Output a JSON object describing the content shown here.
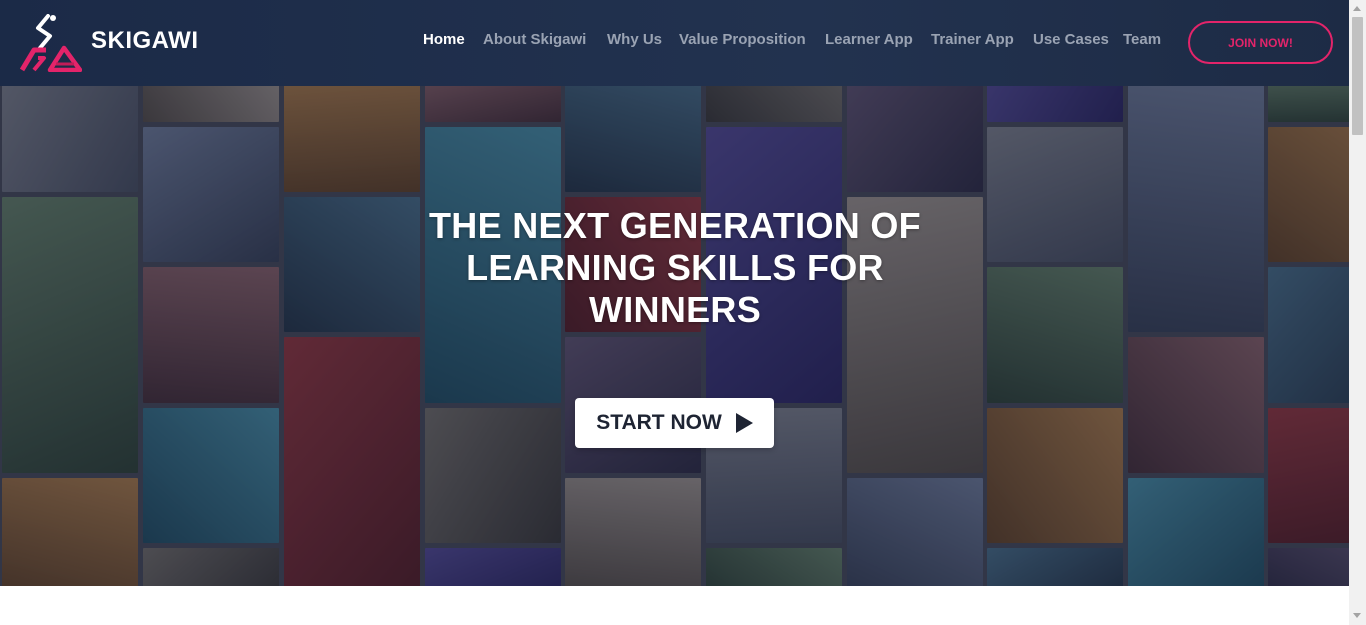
{
  "brand": {
    "name": "SKIGAWI"
  },
  "nav": {
    "items": [
      {
        "label": "Home",
        "active": true
      },
      {
        "label": "About Skigawi",
        "active": false
      },
      {
        "label": "Why Us",
        "active": false
      },
      {
        "label": "Value Proposition",
        "active": false
      },
      {
        "label": "Learner App",
        "active": false
      },
      {
        "label": "Trainer App",
        "active": false
      },
      {
        "label": "Use Cases",
        "active": false
      },
      {
        "label": "Team",
        "active": false
      }
    ],
    "cta_label": "JOIN NOW!"
  },
  "hero": {
    "title": "THE NEXT GENERATION OF LEARNING SKILLS FOR WINNERS",
    "cta_label": "START NOW",
    "cta_icon": "play-icon"
  },
  "colors": {
    "header_bg": "#1f2e4b",
    "accent": "#e3246a",
    "nav_active": "#ffffff",
    "nav_inactive": "#9aa3b3"
  }
}
